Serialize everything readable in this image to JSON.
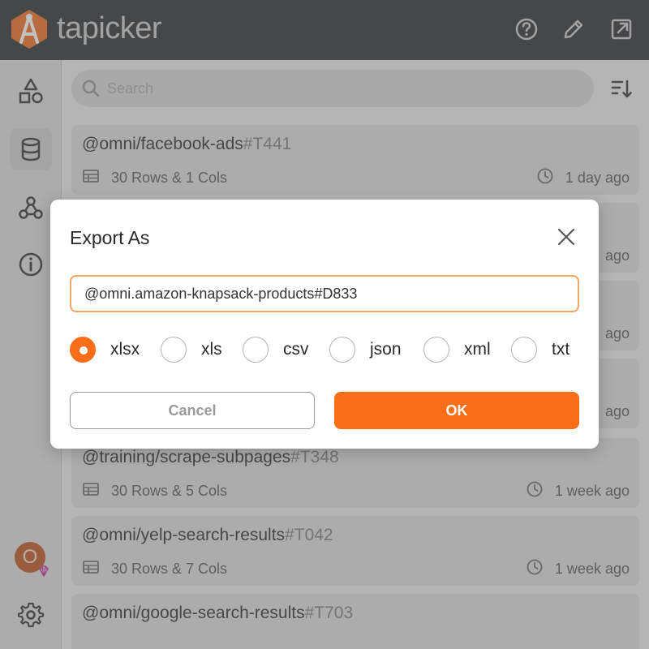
{
  "app": {
    "brand": "tapicker",
    "icons": {
      "logo": "tapicker-logo",
      "help": "help-circle-icon",
      "edit": "pencil-icon",
      "open": "open-external-icon"
    }
  },
  "sidebar": {
    "items": [
      {
        "name": "shapes-icon",
        "active": false
      },
      {
        "name": "database-icon",
        "active": true
      },
      {
        "name": "webhook-icon",
        "active": false
      },
      {
        "name": "info-icon",
        "active": false
      }
    ],
    "avatar_initial": "O",
    "settings_icon": "gear-icon"
  },
  "search": {
    "placeholder": "Search",
    "value": ""
  },
  "list": {
    "items": [
      {
        "title": "@omni/facebook-ads",
        "tag": "#T441",
        "meta": "30 Rows & 1 Cols",
        "time": "1 day ago"
      },
      {
        "title": "",
        "tag": "",
        "meta": "",
        "time": "ago"
      },
      {
        "title": "",
        "tag": "",
        "meta": "",
        "time": "ago"
      },
      {
        "title": "",
        "tag": "",
        "meta": "",
        "time": "ago"
      },
      {
        "title": "@training/scrape-subpages",
        "tag": "#T348",
        "meta": "30 Rows & 5 Cols",
        "time": "1 week ago"
      },
      {
        "title": "@omni/yelp-search-results",
        "tag": "#T042",
        "meta": "30 Rows & 7 Cols",
        "time": "1 week ago"
      },
      {
        "title": "@omni/google-search-results",
        "tag": "#T703",
        "meta": "",
        "time": ""
      }
    ]
  },
  "dialog": {
    "title": "Export As",
    "filename": "@omni.amazon-knapsack-products#D833",
    "formats": [
      {
        "label": "xlsx",
        "checked": true
      },
      {
        "label": "xls",
        "checked": false
      },
      {
        "label": "csv",
        "checked": false
      },
      {
        "label": "json",
        "checked": false
      },
      {
        "label": "xml",
        "checked": false
      },
      {
        "label": "txt",
        "checked": false
      }
    ],
    "cancel_label": "Cancel",
    "ok_label": "OK"
  },
  "colors": {
    "accent": "#fa6e1a",
    "topbar": "#2a2b2f",
    "input_border": "#f3a562"
  }
}
